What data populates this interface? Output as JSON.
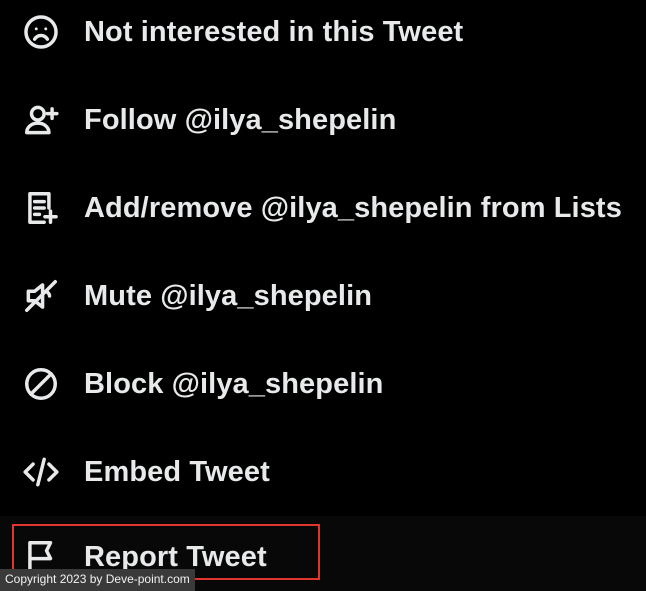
{
  "menu": {
    "items": [
      {
        "label": "Not interested in this Tweet",
        "icon": "frown-face-icon"
      },
      {
        "label": "Follow @ilya_shepelin",
        "icon": "user-plus-icon"
      },
      {
        "label": "Add/remove @ilya_shepelin from Lists",
        "icon": "list-add-icon"
      },
      {
        "label": "Mute @ilya_shepelin",
        "icon": "speaker-mute-icon"
      },
      {
        "label": "Block @ilya_shepelin",
        "icon": "block-icon"
      },
      {
        "label": "Embed Tweet",
        "icon": "code-icon"
      },
      {
        "label": "Report Tweet",
        "icon": "flag-icon"
      }
    ]
  },
  "watermark": {
    "text": "Copyright 2023 by Deve-point.com"
  },
  "colors": {
    "background": "#000000",
    "text": "#e7e9ea",
    "highlight_border": "#e0362d",
    "hover_background": "#080808"
  }
}
